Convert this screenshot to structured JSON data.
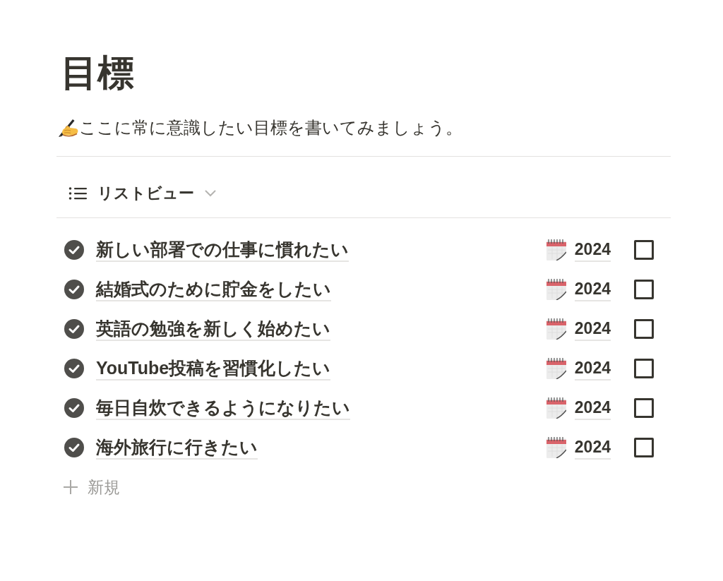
{
  "page": {
    "title": "目標",
    "description": "ここに常に意識したい目標を書いてみましょう。"
  },
  "view": {
    "label": "リストビュー"
  },
  "items": [
    {
      "title": "新しい部署での仕事に慣れたい",
      "date": "2024",
      "checked": false
    },
    {
      "title": "結婚式のために貯金をしたい",
      "date": "2024",
      "checked": false
    },
    {
      "title": "英語の勉強を新しく始めたい",
      "date": "2024",
      "checked": false
    },
    {
      "title": "YouTube投稿を習慣化したい",
      "date": "2024",
      "checked": false
    },
    {
      "title": "毎日自炊できるようになりたい",
      "date": "2024",
      "checked": false
    },
    {
      "title": "海外旅行に行きたい",
      "date": "2024",
      "checked": false
    }
  ],
  "new_button": {
    "label": "新規"
  }
}
